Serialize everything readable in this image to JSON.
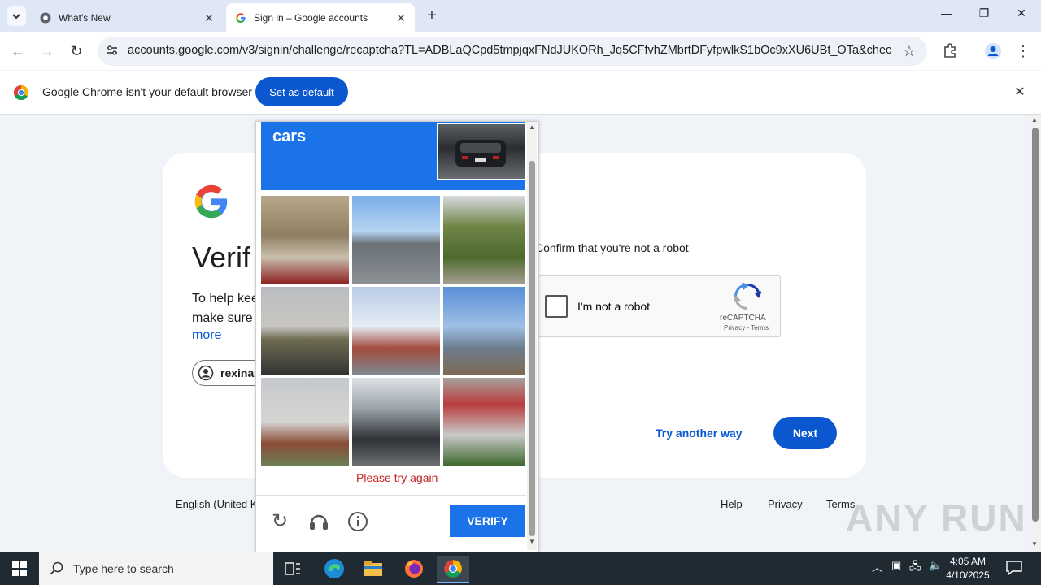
{
  "browser": {
    "tabs": [
      {
        "title": "What's New"
      },
      {
        "title": "Sign in – Google accounts"
      }
    ],
    "url": {
      "host": "accounts.google.com",
      "path": "/v3/signin/challenge/recaptcha?TL=ADBLaQCpd5tmpjqxFNdJUKORh_Jq5CFfvhZMbrtDFyfpwlkS1bOc9xXU6UBt_OTa&checkConnec..."
    },
    "infobar": {
      "message": "Google Chrome isn't your default browser",
      "button": "Set as default"
    }
  },
  "signin": {
    "title_partial": "Verif",
    "desc_line1": "To help kee",
    "desc_line2": "make sure",
    "more": "more",
    "account_partial": "rexina",
    "confirm": "Confirm that you're not a robot",
    "recaptcha_label": "I'm not a robot",
    "recaptcha_brand": "reCAPTCHA",
    "recaptcha_links": "Privacy - Terms",
    "try_another": "Try another way",
    "next": "Next"
  },
  "footer": {
    "language": "English (United Ki",
    "help": "Help",
    "privacy": "Privacy",
    "terms": "Terms"
  },
  "captcha": {
    "target": "cars",
    "error": "Please try again",
    "verify": "VERIFY"
  },
  "watermark": "ANY RUN",
  "taskbar": {
    "search_placeholder": "Type here to search",
    "time": "4:05 AM",
    "date": "4/10/2025"
  }
}
